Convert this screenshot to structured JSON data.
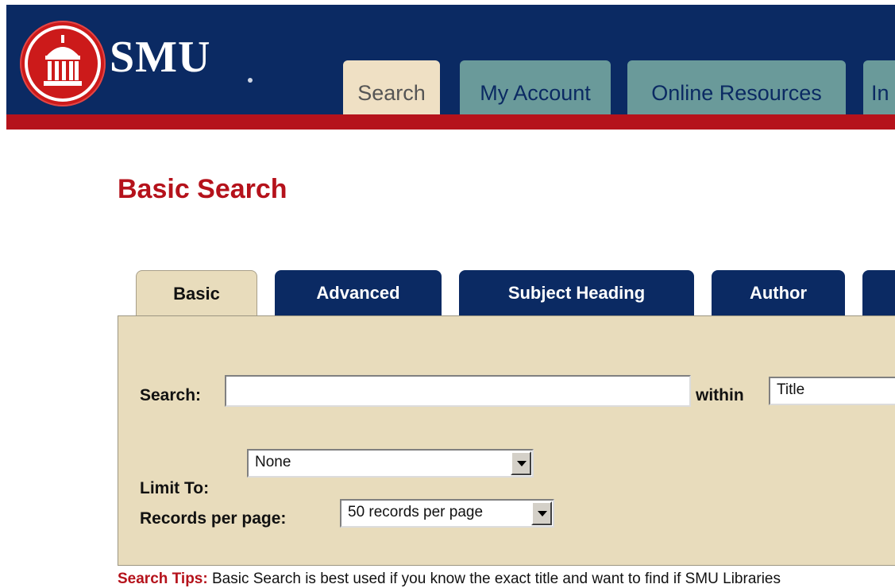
{
  "brand": {
    "name": "SMU",
    "colors": {
      "navy": "#0b2a63",
      "red": "#b5121b",
      "tab_teal": "#6a9a9a",
      "panel_tan": "#e8dcbc"
    }
  },
  "top_nav": {
    "tabs": [
      {
        "label": "Search",
        "active": true
      },
      {
        "label": "My Account",
        "active": false
      },
      {
        "label": "Online Resources",
        "active": false
      },
      {
        "label": "In",
        "active": false
      }
    ]
  },
  "page_title": "Basic Search",
  "search_tabs": [
    {
      "label": "Basic",
      "active": true
    },
    {
      "label": "Advanced",
      "active": false
    },
    {
      "label": "Subject Heading",
      "active": false
    },
    {
      "label": "Author",
      "active": false
    }
  ],
  "form": {
    "search_label": "Search:",
    "search_value": "",
    "within_label": "within",
    "within_selected": "Title",
    "limit_label": "Limit To:",
    "limit_selected": "None",
    "records_label": "Records per page:",
    "records_selected": "50 records per page"
  },
  "tips": {
    "label": "Search Tips:",
    "text": "Basic Search is best used if you know the exact title and want to find if SMU Libraries"
  },
  "icons": {
    "logo": "smu-dome-seal-icon",
    "dropdown": "chevron-down-icon"
  }
}
